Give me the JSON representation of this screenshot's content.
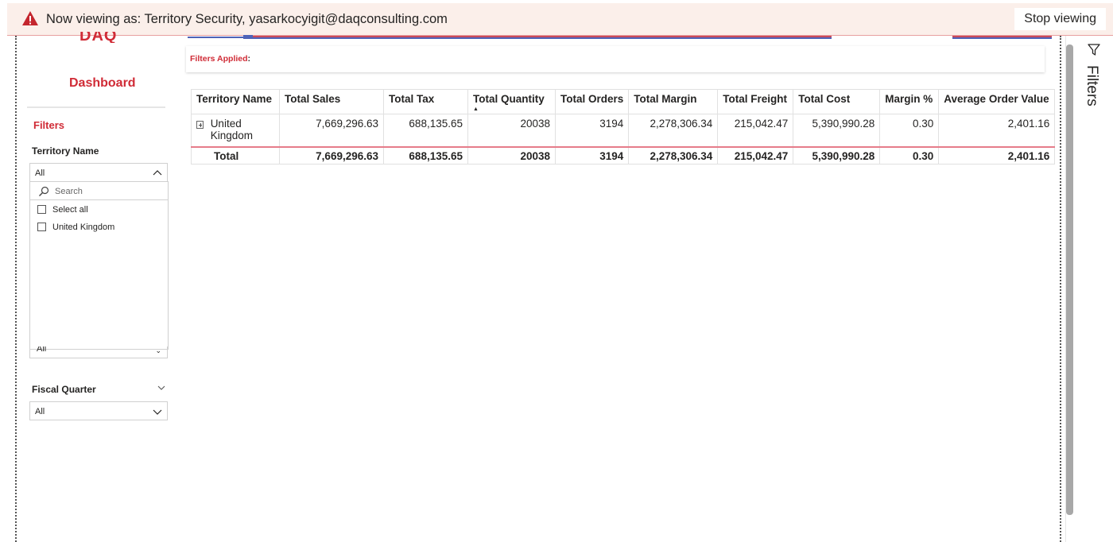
{
  "banner": {
    "message": "Now viewing as: Territory Security, yasarkocyigit@daqconsulting.com",
    "stop_label": "Stop viewing"
  },
  "left_panel": {
    "logo": "DAQ",
    "dashboard_title": "Dashboard",
    "filters_title": "Filters",
    "territory_label": "Territory Name",
    "territory_value": "All",
    "search_placeholder": "Search",
    "options": [
      "Select all",
      "United Kingdom"
    ],
    "hidden_dropdown_value": "All",
    "fiscal_quarter_label": "Fiscal Quarter",
    "fiscal_quarter_value": "All"
  },
  "filters_applied": {
    "label": "Filters Applied",
    "colon": ":"
  },
  "table": {
    "headers": [
      "Territory Name",
      "Total Sales",
      "Total Tax",
      "Total Quantity",
      "Total Orders",
      "Total Margin",
      "Total Freight",
      "Total Cost",
      "Margin %",
      "Average Order Value"
    ],
    "rows": [
      [
        "United Kingdom",
        "7,669,296.63",
        "688,135.65",
        "20038",
        "3194",
        "2,278,306.34",
        "215,042.47",
        "5,390,990.28",
        "0.30",
        "2,401.16"
      ]
    ],
    "total": [
      "Total",
      "7,669,296.63",
      "688,135.65",
      "20038",
      "3194",
      "2,278,306.34",
      "215,042.47",
      "5,390,990.28",
      "0.30",
      "2,401.16"
    ],
    "sorted_column": "Total Quantity",
    "sort_direction": "ascending"
  },
  "right_pane": {
    "label": "Filters"
  },
  "colors": {
    "accent": "#d02b36",
    "banner_bg": "#fbefea",
    "total_rule": "#e67c8a",
    "bar_blue": "#4f63b8"
  }
}
